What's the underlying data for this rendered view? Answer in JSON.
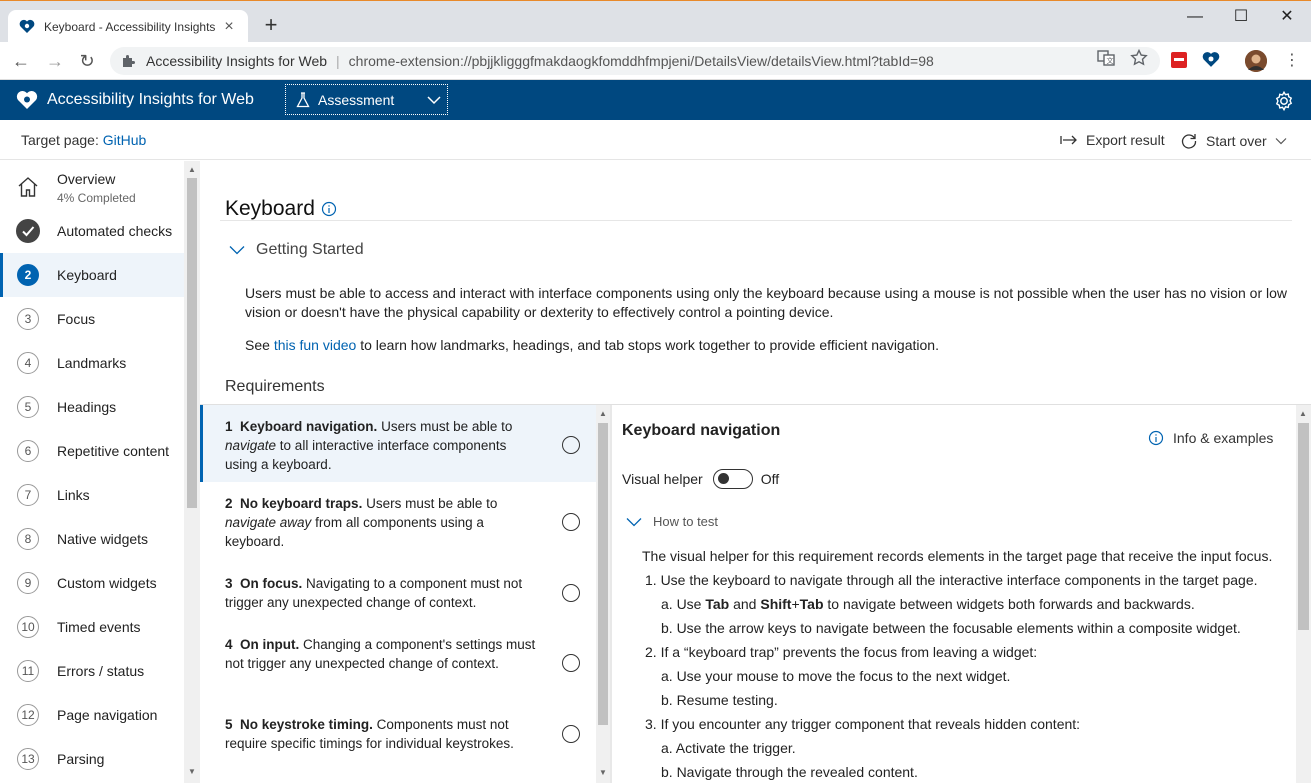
{
  "browser": {
    "tab_title": "Keyboard - Accessibility Insights",
    "tab_close": "×",
    "new_tab": "+",
    "win_minimize": "—",
    "win_maximize": "☐",
    "win_close": "✕",
    "back": "←",
    "forward": "→",
    "reload": "↻",
    "origin": "Accessibility Insights for Web",
    "url": "chrome-extension://pbjjkligggfmakdaogkfomddhfmpjeni/DetailsView/detailsView.html?tabId=98"
  },
  "app": {
    "title": "Accessibility Insights for Web",
    "mode": "Assessment"
  },
  "command_bar": {
    "target_label": "Target page: ",
    "target_link": "GitHub",
    "export": "Export result",
    "start_over": "Start over"
  },
  "nav": {
    "overview": "Overview",
    "overview_progress": "4% Completed",
    "items": [
      {
        "num": "",
        "label": "Automated checks"
      },
      {
        "num": "2",
        "label": "Keyboard"
      },
      {
        "num": "3",
        "label": "Focus"
      },
      {
        "num": "4",
        "label": "Landmarks"
      },
      {
        "num": "5",
        "label": "Headings"
      },
      {
        "num": "6",
        "label": "Repetitive content"
      },
      {
        "num": "7",
        "label": "Links"
      },
      {
        "num": "8",
        "label": "Native widgets"
      },
      {
        "num": "9",
        "label": "Custom widgets"
      },
      {
        "num": "10",
        "label": "Timed events"
      },
      {
        "num": "11",
        "label": "Errors / status"
      },
      {
        "num": "12",
        "label": "Page navigation"
      },
      {
        "num": "13",
        "label": "Parsing"
      }
    ]
  },
  "main": {
    "title": "Keyboard",
    "getting_started": "Getting Started",
    "gs_paragraph": "Users must be able to access and interact with interface components using only the keyboard because using a mouse is not possible when the user has no vision or low vision or doesn't have the physical capability or dexterity to effectively control a pointing device.",
    "gs_see": "See ",
    "gs_link": "this fun video",
    "gs_after": " to learn how landmarks, headings, and tab stops work together to provide efficient navigation.",
    "requirements": "Requirements",
    "reqs": [
      {
        "num": "1",
        "name": "Keyboard navigation.",
        "text_a": " Users must be able to ",
        "em": "navigate",
        "text_b": " to all interactive interface components using a keyboard."
      },
      {
        "num": "2",
        "name": "No keyboard traps.",
        "text_a": " Users must be able to ",
        "em": "navigate away",
        "text_b": " from all components using a keyboard."
      },
      {
        "num": "3",
        "name": "On focus.",
        "text_a": " Navigating to a component must not trigger any unexpected change of context.",
        "em": "",
        "text_b": ""
      },
      {
        "num": "4",
        "name": "On input.",
        "text_a": " Changing a component's settings must not trigger any unexpected change of context.",
        "em": "",
        "text_b": ""
      },
      {
        "num": "5",
        "name": "No keystroke timing.",
        "text_a": " Components must not require specific timings for individual keystrokes.",
        "em": "",
        "text_b": ""
      }
    ]
  },
  "detail": {
    "title": "Keyboard navigation",
    "info": "Info & examples",
    "visual_helper": "Visual helper",
    "toggle_state": "Off",
    "how_to_test": "How to test",
    "lines": [
      "The visual helper for this requirement records elements in the target page that receive the input focus.",
      "1. Use the keyboard to navigate through all the interactive interface components in the target page.",
      "a. Use ",
      "b. Use the arrow keys to navigate between the focusable elements within a composite widget.",
      "2. If a “keyboard trap” prevents the focus from leaving a widget:",
      "a. Use your mouse to move the focus to the next widget.",
      "b. Resume testing.",
      "3. If you encounter any trigger component that reveals hidden content:",
      "a. Activate the trigger.",
      "b. Navigate through the revealed content."
    ],
    "kbd_tab": "Tab",
    "and": " and ",
    "kbd_shift": "Shift",
    "plus": "+",
    "kbd_tab2": "Tab",
    "line3_tail": " to navigate between widgets both forwards and backwards."
  }
}
